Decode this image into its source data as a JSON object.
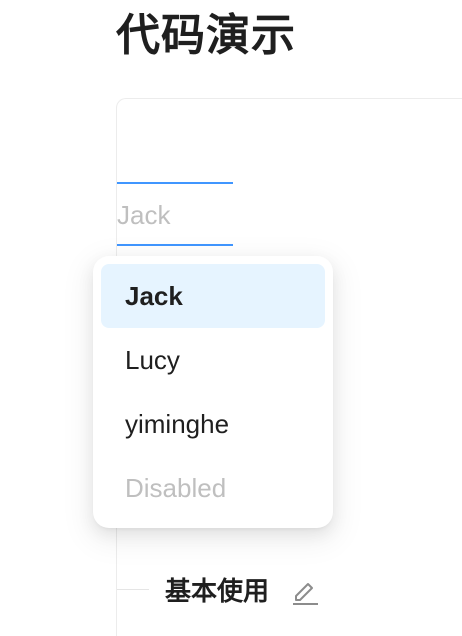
{
  "page": {
    "title": "代码演示"
  },
  "select": {
    "placeholder": "Jack",
    "options": [
      {
        "label": "Jack",
        "selected": true,
        "disabled": false
      },
      {
        "label": "Lucy",
        "selected": false,
        "disabled": false
      },
      {
        "label": "yiminghe",
        "selected": false,
        "disabled": false
      },
      {
        "label": "Disabled",
        "selected": false,
        "disabled": true
      }
    ]
  },
  "section": {
    "title": "基本使用",
    "edit_icon": "edit-pencil-icon"
  },
  "colors": {
    "accent": "#4096ff",
    "selected_bg": "#e6f4ff",
    "placeholder": "#bfbfbf",
    "text": "#1f1f1f"
  }
}
